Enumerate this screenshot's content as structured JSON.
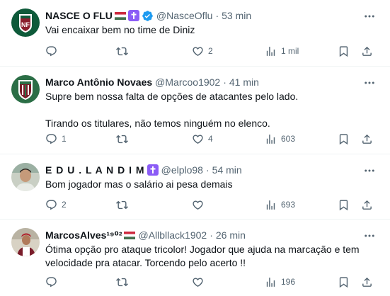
{
  "tweets": [
    {
      "name": "NASCE O FLU",
      "handle": "@NasceOflu",
      "time": "53 min",
      "lines": [
        "Vai encaixar bem no time de Diniz"
      ],
      "replies": "",
      "retweets": "",
      "likes": "2",
      "views": "1 mil"
    },
    {
      "name": "Marco Antônio Novaes",
      "handle": "@Marcoo1902",
      "time": "41 min",
      "lines": [
        "Supre bem nossa falta de opções de atacantes pelo lado.",
        "",
        "Tirando os titulares, não temos ninguém no elenco."
      ],
      "replies": "1",
      "retweets": "",
      "likes": "4",
      "views": "603"
    },
    {
      "name": "E D U . L A N D I M",
      "handle": "@elplo98",
      "time": "54 min",
      "lines": [
        "Bom jogador mas o salário ai pesa demais"
      ],
      "replies": "2",
      "retweets": "",
      "likes": "",
      "views": "693"
    },
    {
      "name": "MarcosAlves¹⁹⁰²",
      "handle": "@Allbllack1902",
      "time": "26 min",
      "lines": [
        "Ótima opção pro ataque tricolor! Jogador que ajuda na marcação e tem",
        "velocidade pra atacar. Torcendo pelo acerto !!"
      ],
      "replies": "",
      "retweets": "",
      "likes": "",
      "views": "196"
    }
  ],
  "separator": "·",
  "colors": {
    "muted": "#536471",
    "text": "#0f1419",
    "verified": "#1d9bf0",
    "cross_badge": "#8b5cf6",
    "border": "#eff3f4"
  }
}
